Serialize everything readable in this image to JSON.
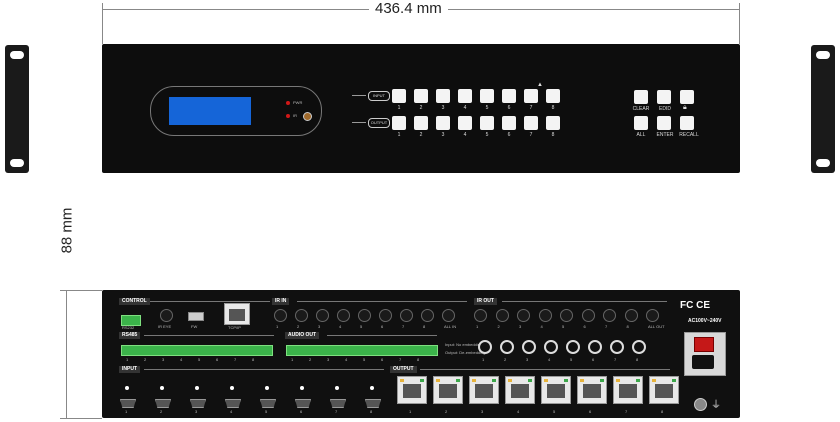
{
  "dimensions": {
    "width_label": "436.4 mm",
    "height_label": "88 mm"
  },
  "front_panel": {
    "leds": [
      "PWR",
      "IR"
    ],
    "input_tag": "INPUT",
    "output_tag": "OUTPUT",
    "channel_numbers": [
      "1",
      "2",
      "3",
      "4",
      "5",
      "6",
      "7",
      "8"
    ],
    "function_buttons_top": [
      "CLEAR",
      "EDID"
    ],
    "function_buttons_bottom": [
      "ALL",
      "ENTER",
      "RECALL"
    ]
  },
  "rear_panel": {
    "sections": {
      "control": "CONTROL",
      "rs485": "RS485",
      "rs232": "RS232",
      "input": "INPUT",
      "audio_out": "AUDIO OUT",
      "ir_in": "IR IN",
      "ir_out": "IR OUT",
      "output": "OUTPUT"
    },
    "control_labels": [
      "IR EYE",
      "FW",
      "TCP/IP"
    ],
    "ir_in_labels": [
      "1",
      "2",
      "3",
      "4",
      "5",
      "6",
      "7",
      "8",
      "ALL IN"
    ],
    "ir_out_labels": [
      "1",
      "2",
      "3",
      "4",
      "5",
      "6",
      "7",
      "8",
      "ALL OUT"
    ],
    "channel_numbers": [
      "1",
      "2",
      "3",
      "4",
      "5",
      "6",
      "7",
      "8"
    ],
    "audio_notes": [
      "Input",
      "No embedding",
      "Output",
      "De-embedding"
    ],
    "cert_marks": "FC CE",
    "power_rating": "AC100V~240V"
  }
}
